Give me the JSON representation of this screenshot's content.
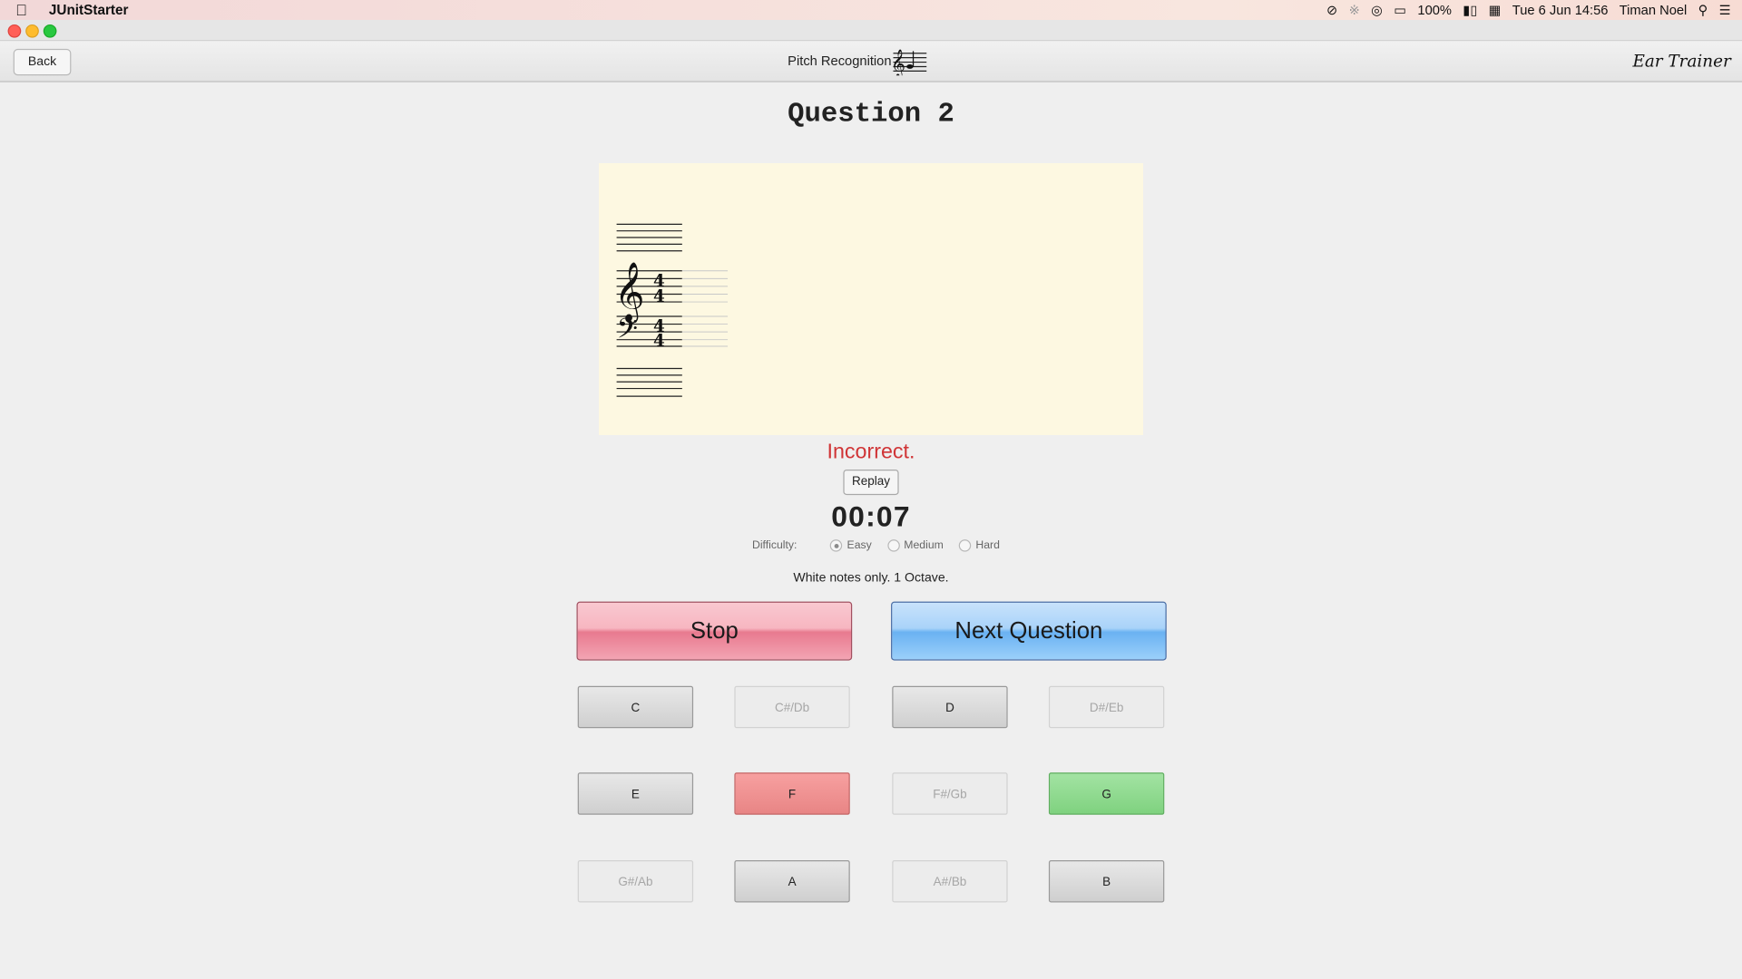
{
  "menubar": {
    "app_name": "JUnitStarter",
    "battery": "100%",
    "datetime": "Tue 6 Jun  14:56",
    "user": "Timan Noel"
  },
  "toolbar": {
    "back_label": "Back",
    "title": "Pitch Recognition",
    "brand": "Ear Trainer"
  },
  "question_title": "Question 2",
  "status_text": "Incorrect.",
  "status_color": "#d03436",
  "replay_label": "Replay",
  "timer": "00:07",
  "difficulty": {
    "label": "Difficulty:",
    "options": [
      "Easy",
      "Medium",
      "Hard"
    ],
    "selected": "Easy"
  },
  "description": "White notes only. 1 Octave.",
  "stop_label": "Stop",
  "next_label": "Next Question",
  "notes": [
    {
      "label": "C",
      "state": "enabled"
    },
    {
      "label": "C#/Db",
      "state": "disabled"
    },
    {
      "label": "D",
      "state": "enabled"
    },
    {
      "label": "D#/Eb",
      "state": "disabled"
    },
    {
      "label": "E",
      "state": "enabled"
    },
    {
      "label": "F",
      "state": "wrong"
    },
    {
      "label": "F#/Gb",
      "state": "disabled"
    },
    {
      "label": "G",
      "state": "correct"
    },
    {
      "label": "G#/Ab",
      "state": "disabled"
    },
    {
      "label": "A",
      "state": "enabled"
    },
    {
      "label": "A#/Bb",
      "state": "disabled"
    },
    {
      "label": "B",
      "state": "enabled"
    }
  ],
  "staff": {
    "time_signature": "4/4",
    "clefs": [
      "treble-clef",
      "bass-clef"
    ]
  }
}
